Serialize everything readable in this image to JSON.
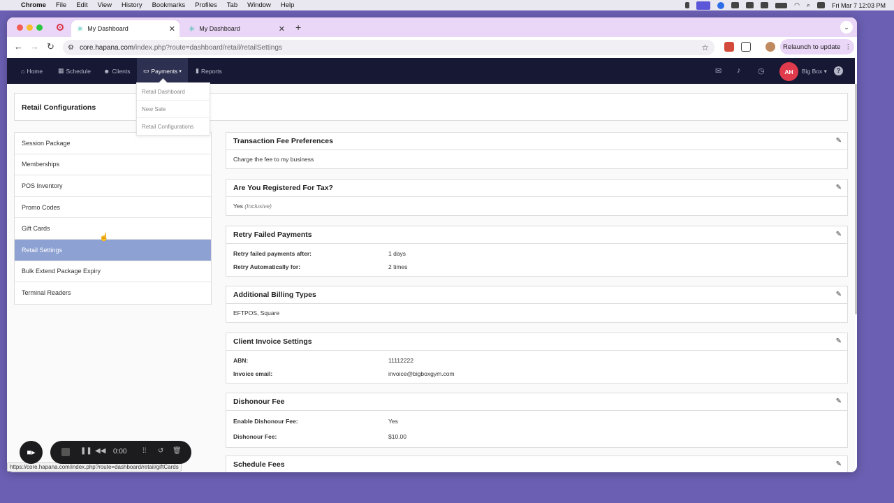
{
  "menubar": {
    "app": "Chrome",
    "items": [
      "File",
      "Edit",
      "View",
      "History",
      "Bookmarks",
      "Profiles",
      "Tab",
      "Window",
      "Help"
    ],
    "datetime": "Fri Mar 7  12:03 PM"
  },
  "browser": {
    "tabs": [
      {
        "title": "My Dashboard",
        "active": true
      },
      {
        "title": "My Dashboard",
        "active": false
      }
    ],
    "url_host": "core.hapana.com",
    "url_path": "/index.php?route=dashboard/retail/retailSettings",
    "relaunch_label": "Relaunch to update",
    "status_url": "https://core.hapana.com/index.php?route=dashboard/retail/giftCards"
  },
  "nav": {
    "items": [
      "Home",
      "Schedule",
      "Clients",
      "Payments",
      "Reports"
    ],
    "active": "Payments",
    "avatar_initials": "AH",
    "account_name": "Big Box",
    "payments_dropdown": [
      "Retail Dashboard",
      "New Sale",
      "Retail Configurations"
    ]
  },
  "page": {
    "title": "Retail Configurations",
    "sidebar": [
      "Session Package",
      "Memberships",
      "POS Inventory",
      "Promo Codes",
      "Gift Cards",
      "Retail Settings",
      "Bulk Extend Package Expiry",
      "Terminal Readers"
    ],
    "active_sidebar": "Retail Settings"
  },
  "panels": {
    "transaction": {
      "title": "Transaction Fee Preferences",
      "value": "Charge the fee to my business"
    },
    "tax": {
      "title": "Are You Registered For Tax?",
      "value": "Yes",
      "note": "(Inclusive)"
    },
    "retry": {
      "title": "Retry Failed Payments",
      "rows": [
        {
          "label": "Retry failed payments after:",
          "value": "1 days"
        },
        {
          "label": "Retry Automatically for:",
          "value": "2 times"
        }
      ]
    },
    "billing": {
      "title": "Additional Billing Types",
      "value": "EFTPOS, Square"
    },
    "invoice": {
      "title": "Client Invoice Settings",
      "rows": [
        {
          "label": "ABN:",
          "value": "11112222"
        },
        {
          "label": "Invoice email:",
          "value": "invoice@bigboxgym.com"
        }
      ]
    },
    "dishonour": {
      "title": "Dishonour Fee",
      "rows": [
        {
          "label": "Enable Dishonour Fee:",
          "value": "Yes"
        },
        {
          "label": "Dishonour Fee:",
          "value": "$10.00"
        }
      ]
    },
    "schedule": {
      "title": "Schedule Fees"
    }
  },
  "recorder": {
    "time": "0:00"
  },
  "colors": {
    "nav_bg": "#171834",
    "active_sidebar": "#8da1d2",
    "avatar": "#e03a4d",
    "tab_strip": "#ead6f6"
  }
}
